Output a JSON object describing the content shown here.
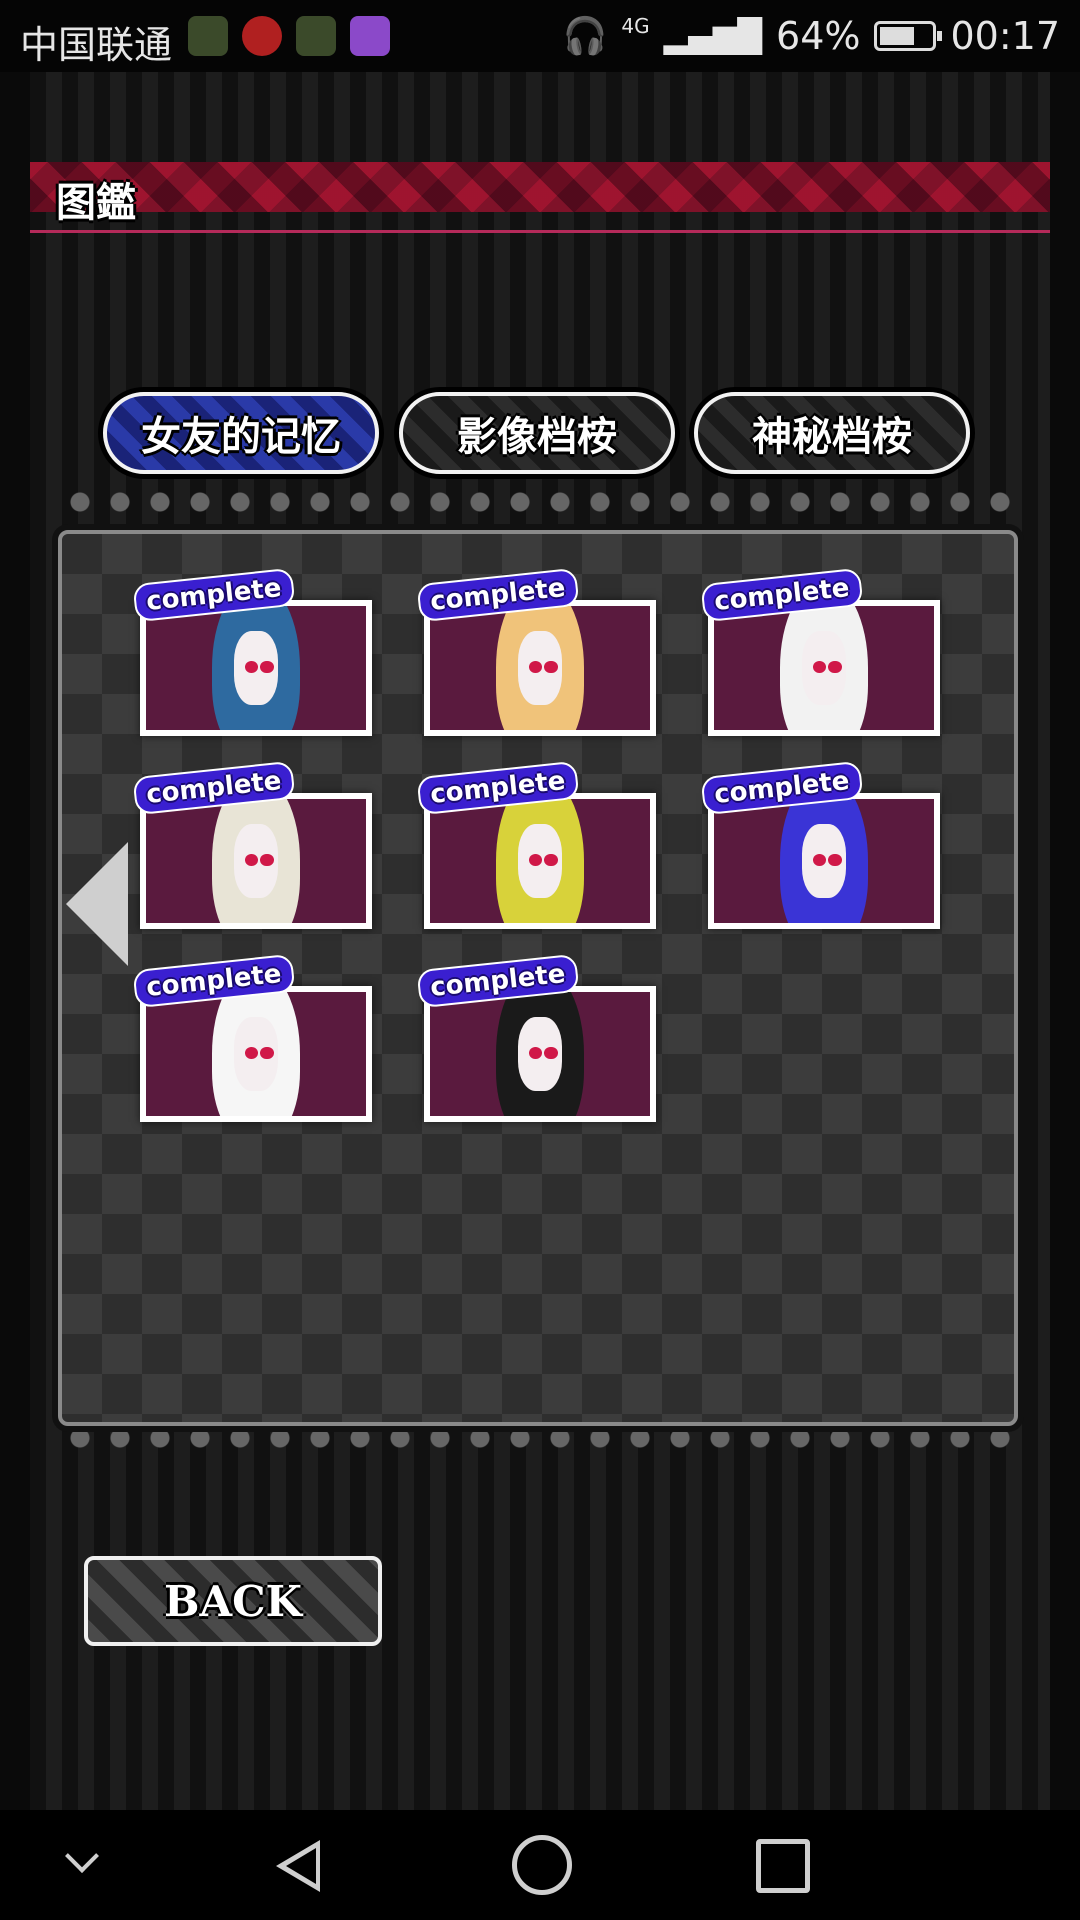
{
  "status_bar": {
    "carrier": "中国联通",
    "network": "4G",
    "battery_percent": "64%",
    "battery_level": 0.64,
    "time": "00:17"
  },
  "screen": {
    "title": "图鑑",
    "tabs": [
      {
        "label": "女友的记忆",
        "active": true
      },
      {
        "label": "影像档桉",
        "active": false
      },
      {
        "label": "神秘档桉",
        "active": false
      }
    ],
    "gallery": [
      {
        "badge": "complete",
        "hair_color": "#2e6aa0"
      },
      {
        "badge": "complete",
        "hair_color": "#f0c37a"
      },
      {
        "badge": "complete",
        "hair_color": "#f2f2f2"
      },
      {
        "badge": "complete",
        "hair_color": "#e8e4d6"
      },
      {
        "badge": "complete",
        "hair_color": "#d8d23a"
      },
      {
        "badge": "complete",
        "hair_color": "#3a34d6"
      },
      {
        "badge": "complete",
        "hair_color": "#f6f6f6"
      },
      {
        "badge": "complete",
        "hair_color": "#1a1a1a"
      }
    ],
    "back_label": "BACK"
  },
  "colors": {
    "accent_pink": "#b52a5a",
    "tab_active": "#2a3aa8",
    "badge_blue": "#3a1fd0"
  }
}
